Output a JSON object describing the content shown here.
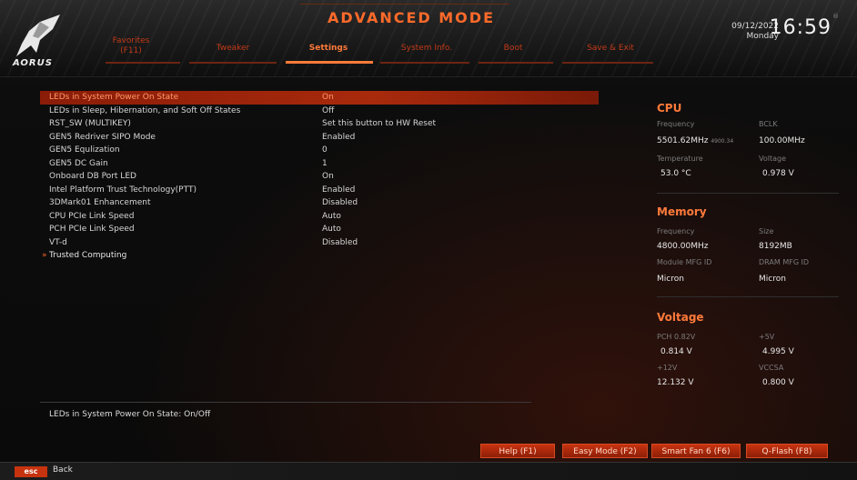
{
  "header": {
    "mode_title": "ADVANCED MODE",
    "brand": "AORUS",
    "date": "09/12/2022",
    "day": "Monday",
    "time": "16:59",
    "reg_mark": "®"
  },
  "tabs": [
    {
      "label": "Favorites",
      "sub": "(F11)"
    },
    {
      "label": "Tweaker"
    },
    {
      "label": "Settings"
    },
    {
      "label": "System Info."
    },
    {
      "label": "Boot"
    },
    {
      "label": "Save & Exit"
    }
  ],
  "settings": [
    {
      "label": "LEDs in System Power On State",
      "value": "On"
    },
    {
      "label": "LEDs in Sleep, Hibernation, and Soft Off States",
      "value": "Off"
    },
    {
      "label": "RST_SW (MULTIKEY)",
      "value": "Set this button to HW Reset"
    },
    {
      "label": "GEN5 Redriver SIPO Mode",
      "value": "Enabled"
    },
    {
      "label": "GEN5 Equlization",
      "value": "0"
    },
    {
      "label": "GEN5 DC Gain",
      "value": "1"
    },
    {
      "label": "Onboard DB Port LED",
      "value": "On"
    },
    {
      "label": "Intel Platform Trust Technology(PTT)",
      "value": "Enabled"
    },
    {
      "label": "3DMark01 Enhancement",
      "value": "Disabled"
    },
    {
      "label": "CPU PCIe Link Speed",
      "value": "Auto"
    },
    {
      "label": "PCH PCIe Link Speed",
      "value": "Auto"
    },
    {
      "label": "VT-d",
      "value": "Disabled"
    }
  ],
  "submenu": {
    "bullet": "»",
    "label": "Trusted Computing"
  },
  "help_text": "LEDs in System Power On State: On/Off",
  "cpu": {
    "title": "CPU",
    "frequency_label": "Frequency",
    "frequency": "5501.62MHz",
    "frequency_sub": "4900.34",
    "bclk_label": "BCLK",
    "bclk": "100.00MHz",
    "temp_label": "Temperature",
    "temp": "53.0 °C",
    "voltage_label": "Voltage",
    "voltage": "0.978 V"
  },
  "memory": {
    "title": "Memory",
    "frequency_label": "Frequency",
    "frequency": "4800.00MHz",
    "size_label": "Size",
    "size": "8192MB",
    "module_label": "Module MFG ID",
    "module": "Micron",
    "dram_label": "DRAM MFG ID",
    "dram": "Micron"
  },
  "voltage": {
    "title": "Voltage",
    "pch_label": "PCH 0.82V",
    "pch": "0.814 V",
    "p5_label": "+5V",
    "p5": "4.995 V",
    "p12_label": "+12V",
    "p12": "12.132 V",
    "vccsa_label": "VCCSA",
    "vccsa": "0.800 V"
  },
  "bottom_buttons": [
    {
      "label": "Help (F1)"
    },
    {
      "label": "Easy Mode (F2)"
    },
    {
      "label": "Smart Fan 6 (F6)"
    },
    {
      "label": "Q-Flash (F8)"
    }
  ],
  "esc": {
    "key": "esc",
    "label": "Back"
  },
  "colors": {
    "accent": "#ff7a3a",
    "highlight": "#a82a0c",
    "button": "#c7330f"
  }
}
